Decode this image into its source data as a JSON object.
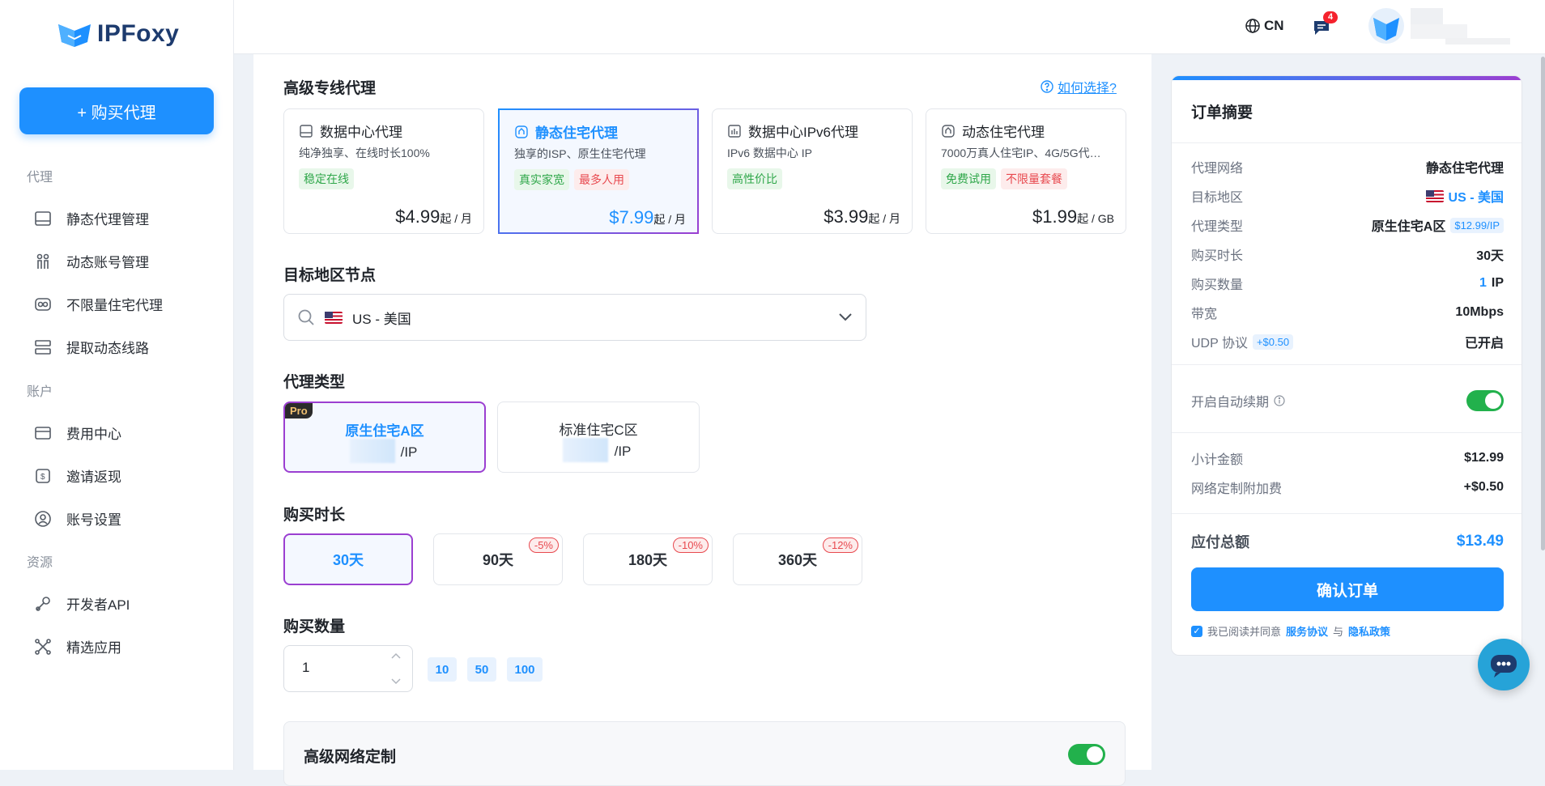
{
  "brand": {
    "name": "IPFoxy"
  },
  "sidebar": {
    "buy_button": "+ 购买代理",
    "sections": [
      {
        "title": "代理",
        "items": [
          "静态代理管理",
          "动态账号管理",
          "不限量住宅代理",
          "提取动态线路"
        ]
      },
      {
        "title": "账户",
        "items": [
          "费用中心",
          "邀请返现",
          "账号设置"
        ]
      },
      {
        "title": "资源",
        "items": [
          "开发者API",
          "精选应用"
        ]
      }
    ]
  },
  "topbar": {
    "language": "CN",
    "notification_count": "4"
  },
  "main": {
    "proxy_section_title": "高级专线代理",
    "help_link": "如何选择?",
    "products": [
      {
        "name": "数据中心代理",
        "desc": "纯净独享、在线时长100%",
        "tags": [
          {
            "text": "稳定在线",
            "kind": "g"
          }
        ],
        "price": "$4.99",
        "unit": "起 / 月"
      },
      {
        "name": "静态住宅代理",
        "desc": "独享的ISP、原生住宅代理",
        "tags": [
          {
            "text": "真实家宽",
            "kind": "g"
          },
          {
            "text": "最多人用",
            "kind": "r"
          }
        ],
        "price": "$7.99",
        "unit": "起 / 月"
      },
      {
        "name": "数据中心IPv6代理",
        "desc": "IPv6 数据中心 IP",
        "tags": [
          {
            "text": "高性价比",
            "kind": "g"
          }
        ],
        "price": "$3.99",
        "unit": "起 / 月"
      },
      {
        "name": "动态住宅代理",
        "desc": "7000万真人住宅IP、4G/5G代…",
        "tags": [
          {
            "text": "免费试用",
            "kind": "g"
          },
          {
            "text": "不限量套餐",
            "kind": "r"
          }
        ],
        "price": "$1.99",
        "unit": "起 / GB"
      }
    ],
    "region_title": "目标地区节点",
    "region_value": "US - 美国",
    "type_title": "代理类型",
    "types": [
      {
        "name": "原生住宅A区",
        "price": "/IP",
        "badge": "Pro"
      },
      {
        "name": "标准住宅C区",
        "price": "/IP"
      }
    ],
    "duration_title": "购买时长",
    "durations": [
      {
        "label": "30天",
        "discount": ""
      },
      {
        "label": "90天",
        "discount": "-5%"
      },
      {
        "label": "180天",
        "discount": "-10%"
      },
      {
        "label": "360天",
        "discount": "-12%"
      }
    ],
    "quantity_title": "购买数量",
    "quantity_value": "1",
    "quick_quantities": [
      "10",
      "50",
      "100"
    ],
    "advanced_title": "高级网络定制"
  },
  "order": {
    "title": "订单摘要",
    "rows": [
      {
        "k": "代理网络",
        "v": "静态住宅代理"
      },
      {
        "k": "目标地区",
        "v": "US - 美国"
      },
      {
        "k": "代理类型",
        "v": "原生住宅A区",
        "tag": "$12.99/IP"
      },
      {
        "k": "购买时长",
        "v": "30天"
      },
      {
        "k": "购买数量",
        "v_num": "1",
        "v": "IP"
      },
      {
        "k": "带宽",
        "v": "10Mbps"
      },
      {
        "k": "UDP 协议",
        "k_tag": "+$0.50",
        "v": "已开启"
      }
    ],
    "auto_renew": "开启自动续期",
    "subtotal_label": "小计金额",
    "subtotal": "$12.99",
    "surcharge_label": "网络定制附加费",
    "surcharge": "+$0.50",
    "total_label": "应付总额",
    "total": "$13.49",
    "confirm": "确认订单",
    "agree_text": "我已阅读并同意",
    "terms": "服务协议",
    "and": "与",
    "privacy": "隐私政策"
  },
  "colors": {
    "accent": "#1e90ff",
    "selected_border": "#9b3fd1",
    "toggle_on": "#22b14c",
    "discount": "#e8494f"
  }
}
